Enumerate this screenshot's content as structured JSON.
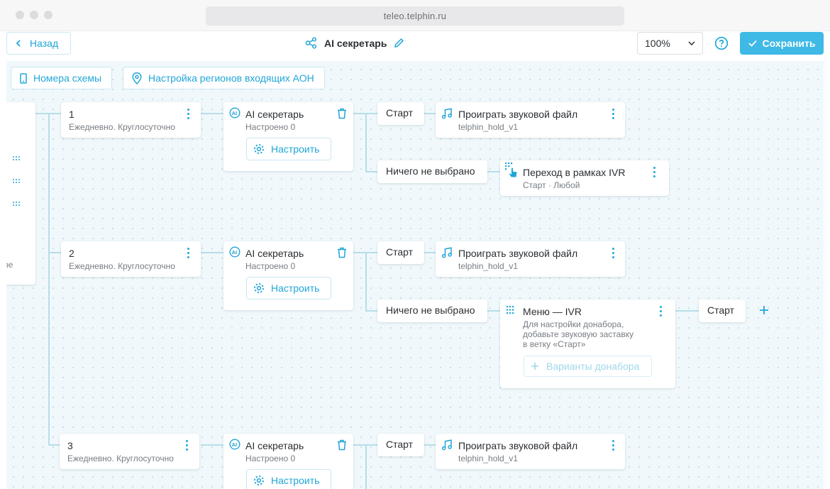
{
  "browser": {
    "url": "teleo.telphin.ru"
  },
  "header": {
    "back_label": "Назад",
    "title": "AI секретарь",
    "zoom_value": "100%",
    "save_label": "Сохранить"
  },
  "toolbar": {
    "numbers_label": "Номера схемы",
    "regions_label": "Настройка регионов входящих АОН"
  },
  "stub": {
    "text": "ne"
  },
  "rows": [
    {
      "schedule": {
        "number": "1",
        "text": "Ежедневно. Круглосуточно"
      },
      "ai": {
        "title": "AI секретарь",
        "status": "Настроено 0",
        "configure_label": "Настроить"
      },
      "start_label": "Старт",
      "play": {
        "title": "Проиграть звуковой файл",
        "file": "telphin_hold_v1"
      },
      "nothing_label": "Ничего не выбрано",
      "jump": {
        "title": "Переход в рамках IVR",
        "sub": "Старт · Любой"
      }
    },
    {
      "schedule": {
        "number": "2",
        "text": "Ежедневно. Круглосуточно"
      },
      "ai": {
        "title": "AI секретарь",
        "status": "Настроено 0",
        "configure_label": "Настроить"
      },
      "start_label": "Старт",
      "play": {
        "title": "Проиграть звуковой файл",
        "file": "telphin_hold_v1"
      },
      "nothing_label": "Ничего не выбрано",
      "menu": {
        "title": "Меню — IVR",
        "desc_1": "Для настройки донабора,",
        "desc_2": "добавьте звуковую заставку",
        "desc_3": "в ветку «Старт»",
        "variants_label": "Варианты донабора",
        "start_label": "Старт"
      }
    },
    {
      "schedule": {
        "number": "3",
        "text": "Ежедневно. Круглосуточно"
      },
      "ai": {
        "title": "AI секретарь",
        "status": "Настроено 0",
        "configure_label": "Настроить"
      },
      "start_label": "Старт",
      "play": {
        "title": "Проиграть звуковой файл",
        "file": "telphin_hold_v1"
      }
    }
  ],
  "colors": {
    "accent": "#21a6d8",
    "save_bg": "#3fb9e6",
    "canvas_bg": "#f0f8fb",
    "line": "#b7dde9"
  }
}
